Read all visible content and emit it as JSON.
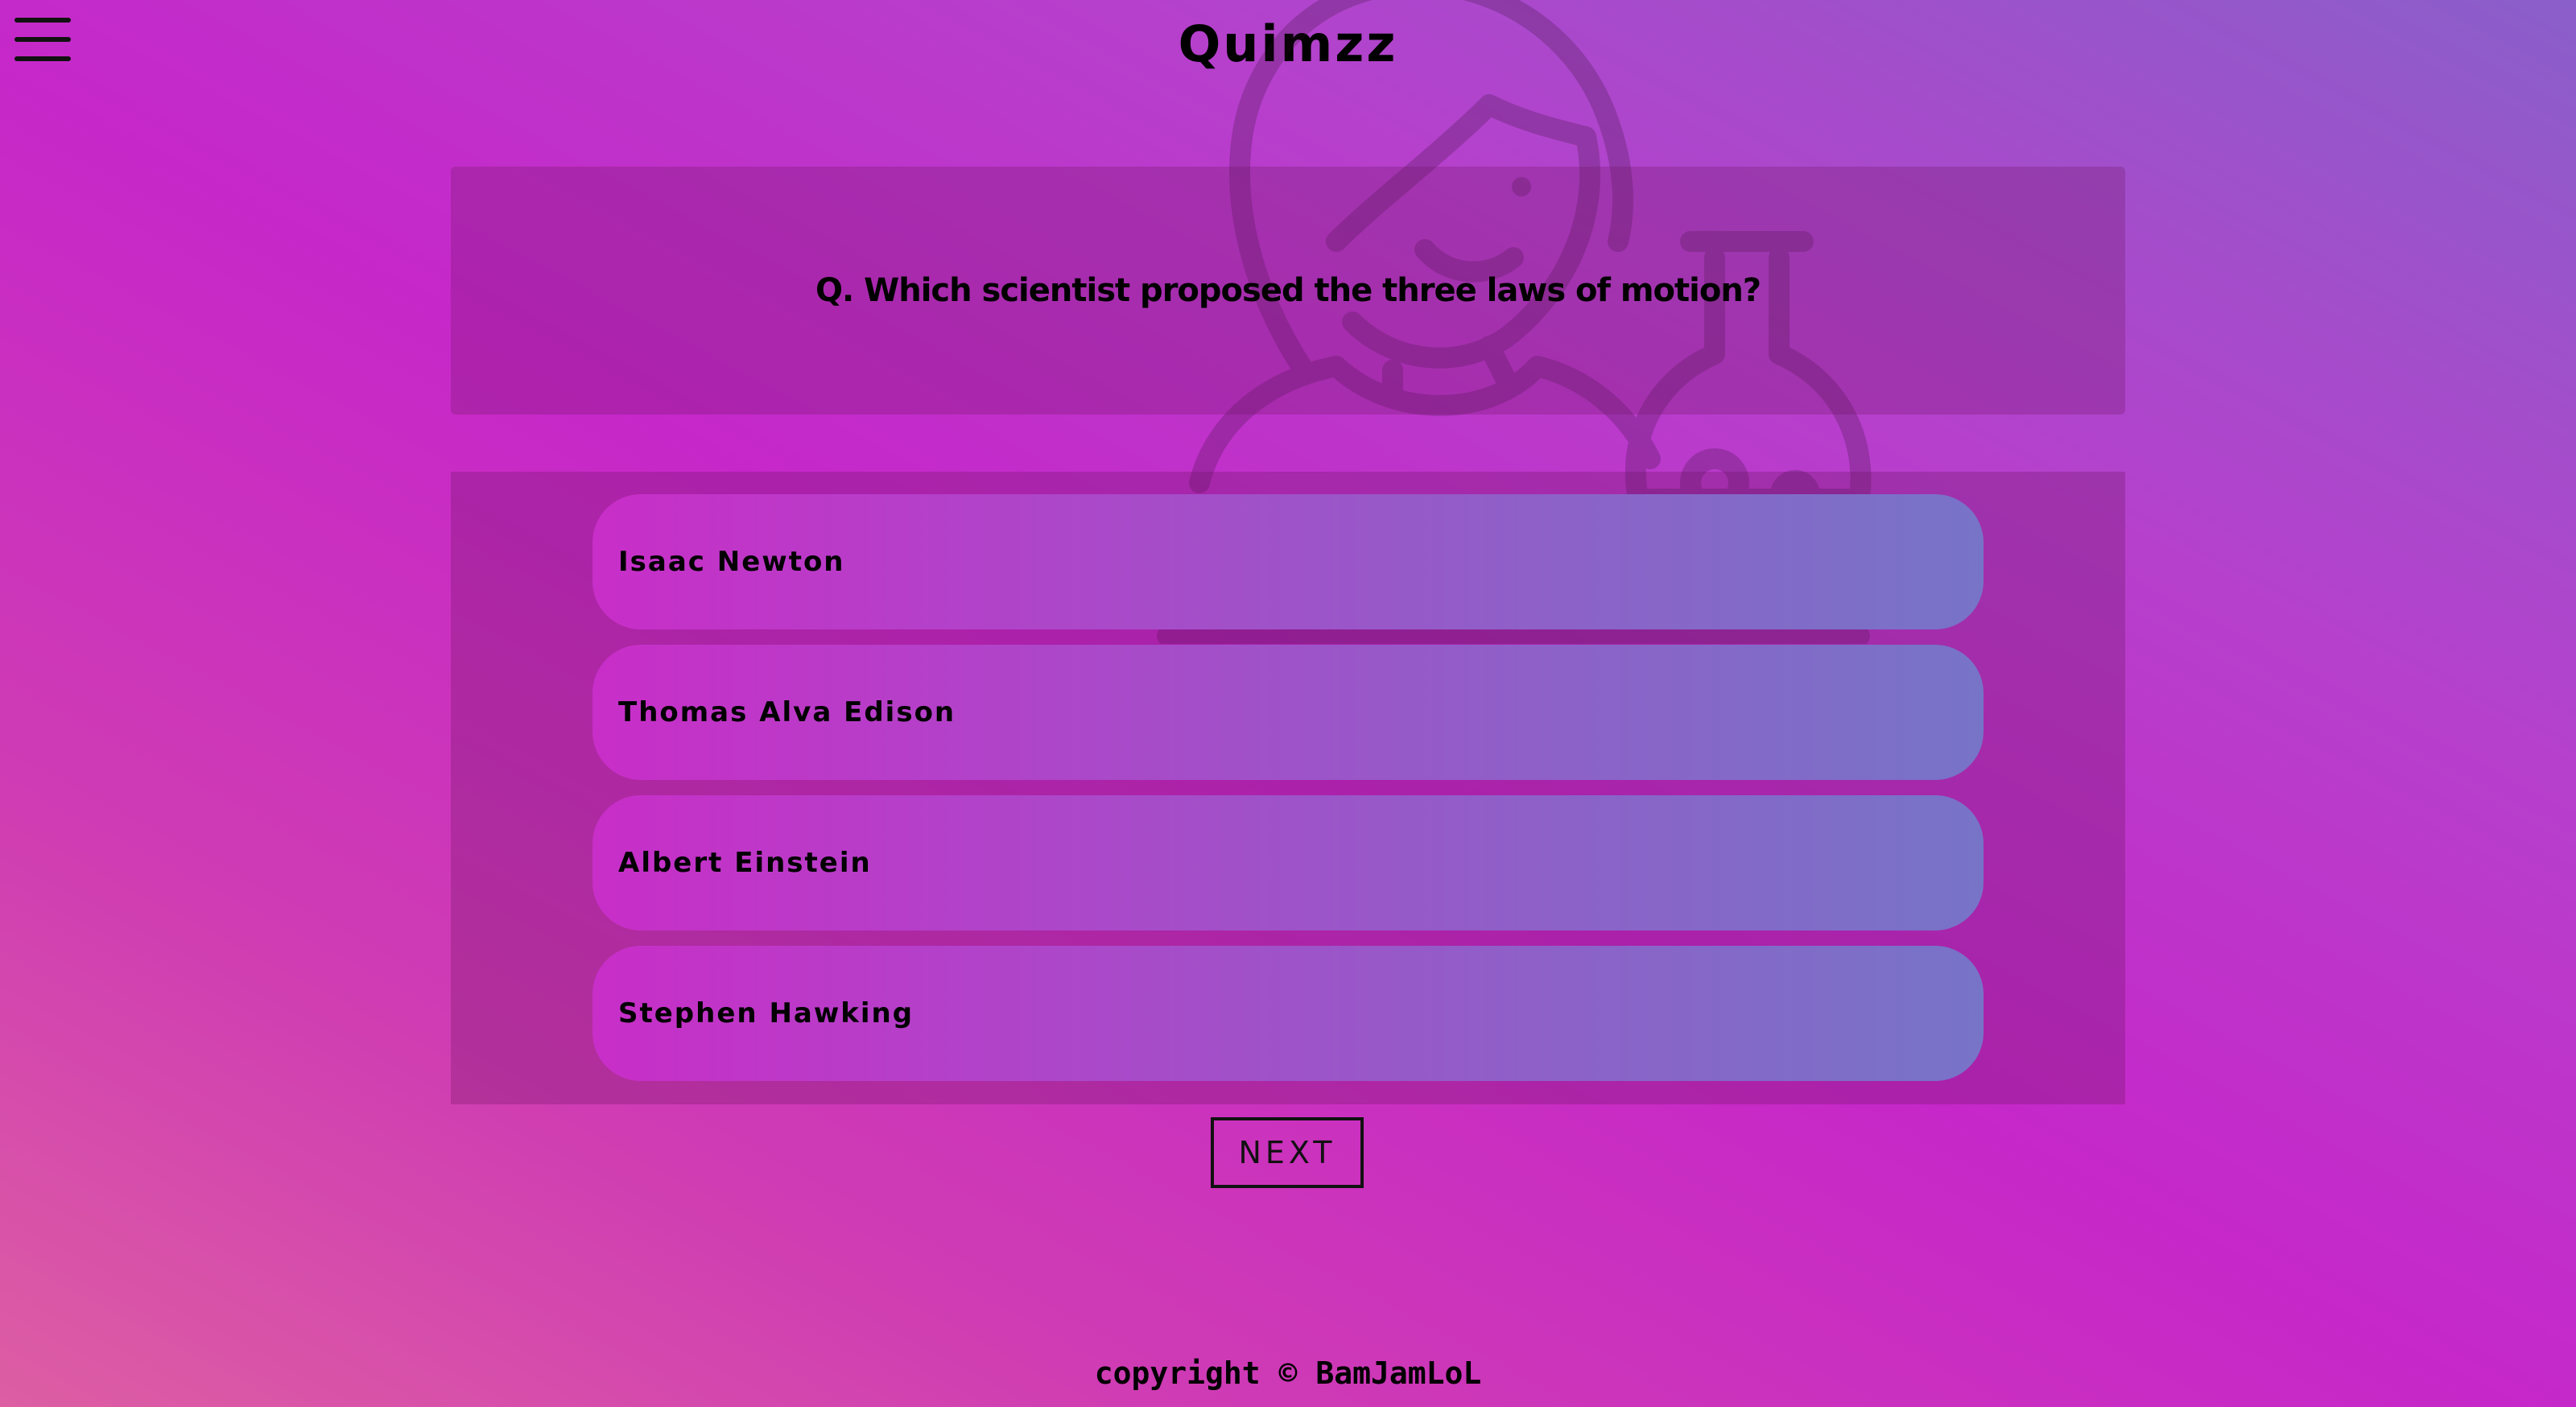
{
  "header": {
    "title": "Quimzz",
    "menu_icon": "hamburger-menu-icon"
  },
  "background": {
    "illustration_icon": "scientist-with-flask-icon"
  },
  "question": {
    "text": "Q. Which scientist proposed the three laws of motion?"
  },
  "options": [
    {
      "label": "Isaac Newton"
    },
    {
      "label": "Thomas Alva Edison"
    },
    {
      "label": "Albert Einstein"
    },
    {
      "label": "Stephen Hawking"
    }
  ],
  "controls": {
    "next_label": "NEXT"
  },
  "footer": {
    "text": "copyright © BamJamLoL"
  },
  "colors": {
    "gradient_start": "#8a5fca",
    "gradient_mid": "#c627c9",
    "gradient_end": "#dd5ea3",
    "option_left": "#c82ec8",
    "option_right": "#7774c8"
  }
}
